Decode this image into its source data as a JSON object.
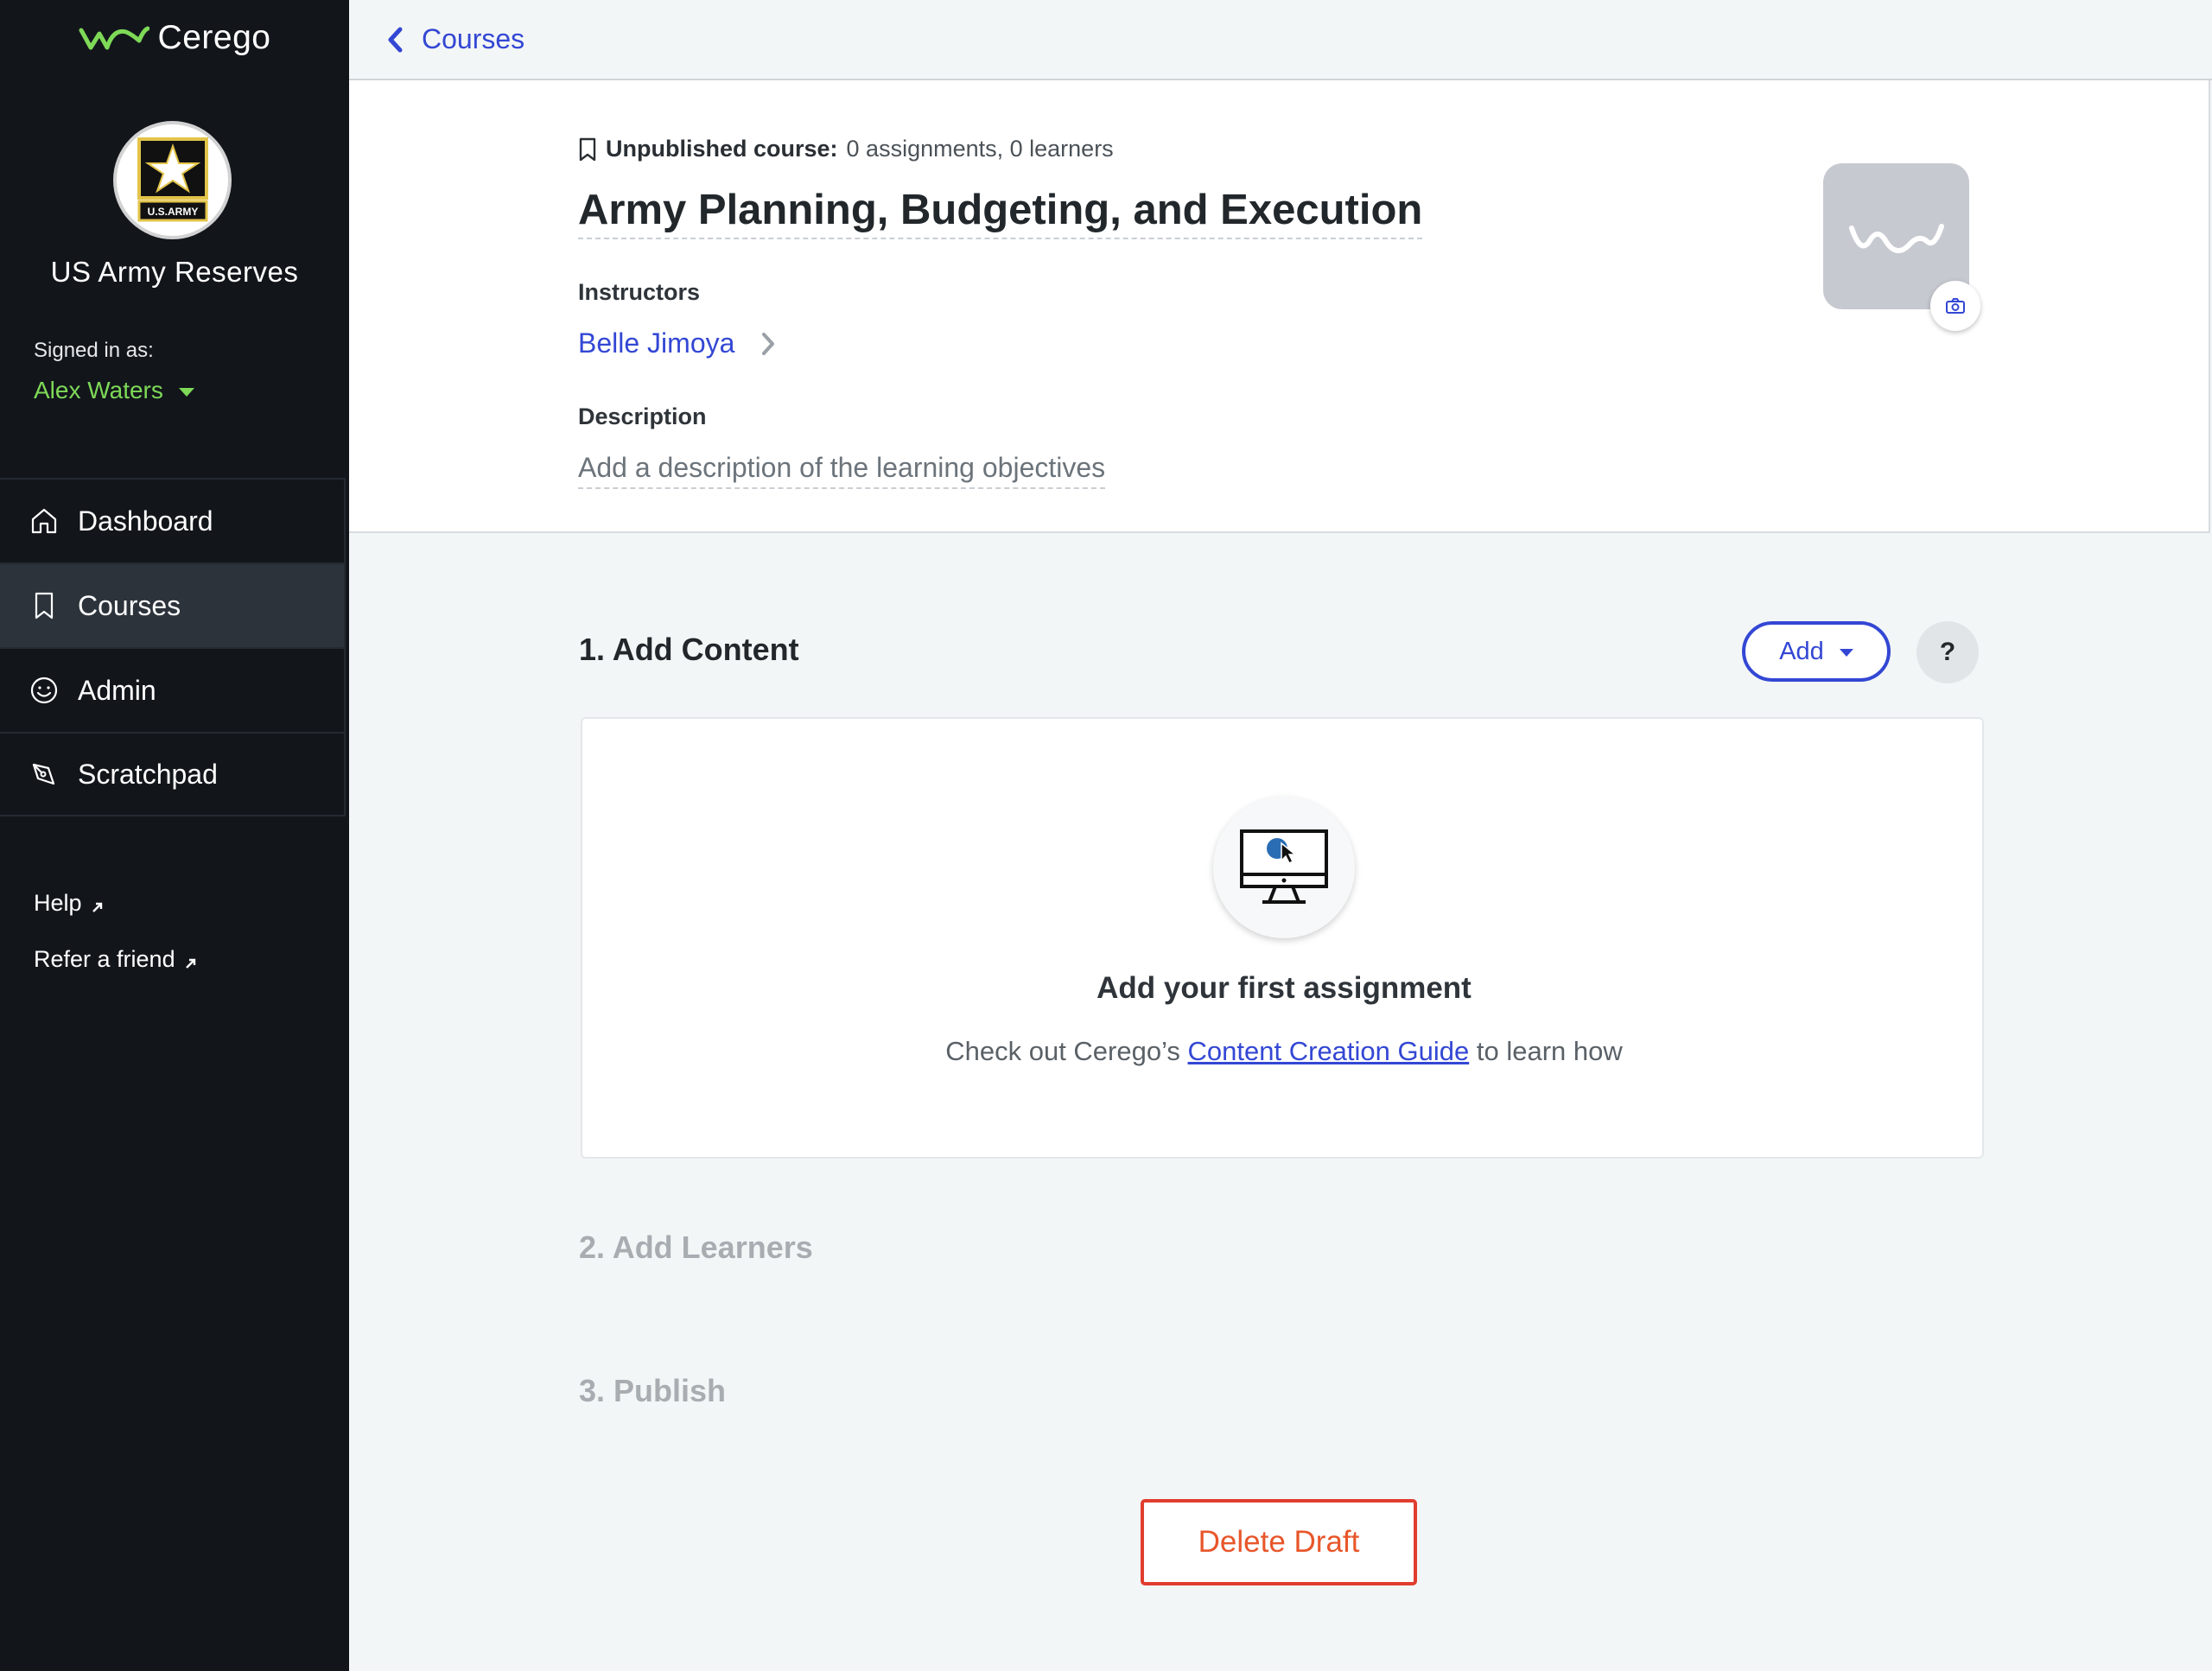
{
  "app": {
    "brand_name": "Cerego",
    "brand_color": "#7ed957",
    "accent_color": "#3347d4",
    "danger_color": "#e03d2f"
  },
  "sidebar": {
    "org_name": "US Army Reserves",
    "org_logo_text": "U.S.ARMY",
    "signed_in_label": "Signed in as:",
    "user_name": "Alex Waters",
    "nav": [
      {
        "label": "Dashboard",
        "icon": "home-icon"
      },
      {
        "label": "Courses",
        "icon": "bookmark-icon",
        "active": true
      },
      {
        "label": "Admin",
        "icon": "smiley-icon"
      },
      {
        "label": "Scratchpad",
        "icon": "pen-icon"
      }
    ],
    "links": [
      {
        "label": "Help",
        "icon": "external-arrow-icon"
      },
      {
        "label": "Refer a friend",
        "icon": "external-arrow-icon"
      }
    ]
  },
  "topbar": {
    "back_label": "Courses"
  },
  "course": {
    "status_label": "Unpublished course:",
    "status_detail": "0 assignments, 0 learners",
    "title": "Army Planning, Budgeting, and Execution",
    "instructors_label": "Instructors",
    "instructor_name": "Belle Jimoya",
    "description_label": "Description",
    "description_placeholder": "Add a description of the learning objectives"
  },
  "steps": {
    "add_content": "1. Add Content",
    "add_learners": "2. Add Learners",
    "publish": "3. Publish",
    "add_button": "Add",
    "help_button": "?"
  },
  "empty_state": {
    "title": "Add your first assignment",
    "sub_prefix": "Check out Cerego’s ",
    "link_text": "Content Creation Guide",
    "sub_suffix": " to learn how"
  },
  "actions": {
    "delete_draft": "Delete Draft"
  }
}
